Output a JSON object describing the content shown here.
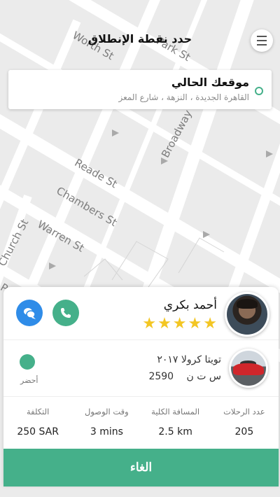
{
  "header": {
    "title": "حدد نقطة الإنطلاق"
  },
  "map": {
    "labels": {
      "street_top": "Park St",
      "street_worth": "Worth St",
      "broadway": "Broadway",
      "reade": "Reade St",
      "chambers": "Chambers St",
      "warren": "Warren St",
      "church": "Church St",
      "park": "Park"
    }
  },
  "location": {
    "title": "موقعك الحالي",
    "address": "القاهرة الجديدة ، النزهة ، شارع المعز"
  },
  "driver": {
    "name": "أحمد بكري",
    "rating": 5,
    "stars": [
      "★",
      "★",
      "★",
      "★",
      "★"
    ]
  },
  "car": {
    "model": "تويتا كرولا ٢٠١٧",
    "plate_letters": "س ت ن",
    "plate_number": "2590"
  },
  "status": {
    "label": "أحضر",
    "color": "#45b08a"
  },
  "stats": [
    {
      "label": "عدد الرحلات",
      "value": "205"
    },
    {
      "label": "المسافة الكلية",
      "value": "2.5 km"
    },
    {
      "label": "وقت الوصول",
      "value": "3 mins"
    },
    {
      "label": "التكلفة",
      "value": "250 SAR"
    }
  ],
  "actions": {
    "cancel_label": "الغاء"
  },
  "colors": {
    "accent": "#45b08a",
    "chat": "#2f8ce8",
    "star": "#f3c623"
  }
}
